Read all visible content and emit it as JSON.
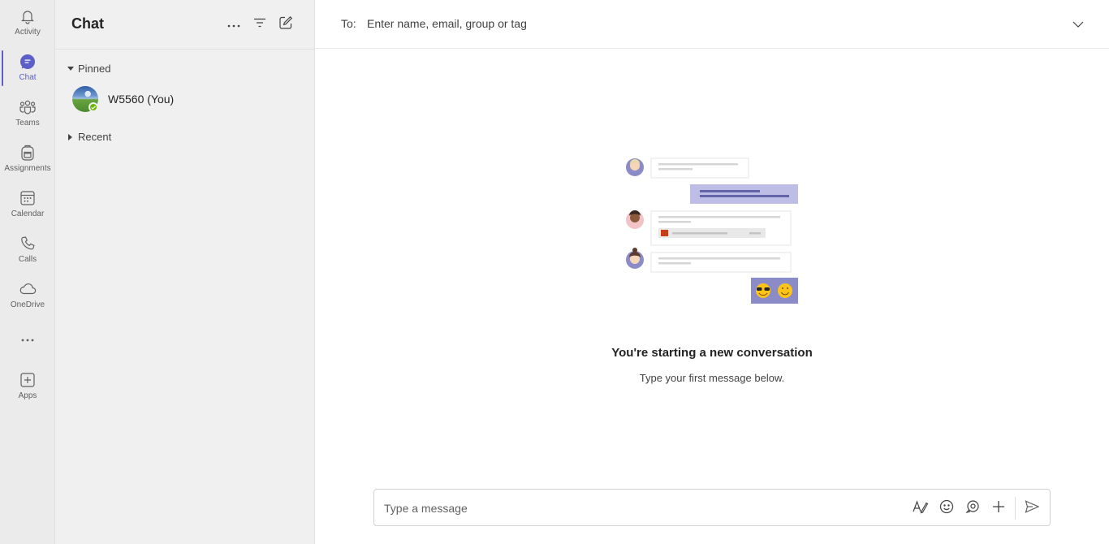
{
  "rail": {
    "items": [
      {
        "label": "Activity",
        "icon": "bell-icon"
      },
      {
        "label": "Chat",
        "icon": "chat-icon"
      },
      {
        "label": "Teams",
        "icon": "teams-icon"
      },
      {
        "label": "Assignments",
        "icon": "backpack-icon"
      },
      {
        "label": "Calendar",
        "icon": "calendar-icon"
      },
      {
        "label": "Calls",
        "icon": "phone-icon"
      },
      {
        "label": "OneDrive",
        "icon": "cloud-icon"
      },
      {
        "label": "Apps",
        "icon": "add-app-icon"
      }
    ],
    "active": "Chat",
    "accent": "#5b5fc7"
  },
  "list": {
    "title": "Chat",
    "pinned_label": "Pinned",
    "recent_label": "Recent",
    "pinned_chats": [
      {
        "name": "W5560 (You)",
        "presence": "available",
        "presence_color": "#6bb700"
      }
    ]
  },
  "main": {
    "to_label": "To:",
    "to_placeholder": "Enter name, email, group or tag",
    "empty_title": "You're starting a new conversation",
    "empty_subtitle": "Type your first message below.",
    "compose_placeholder": "Type a message"
  }
}
